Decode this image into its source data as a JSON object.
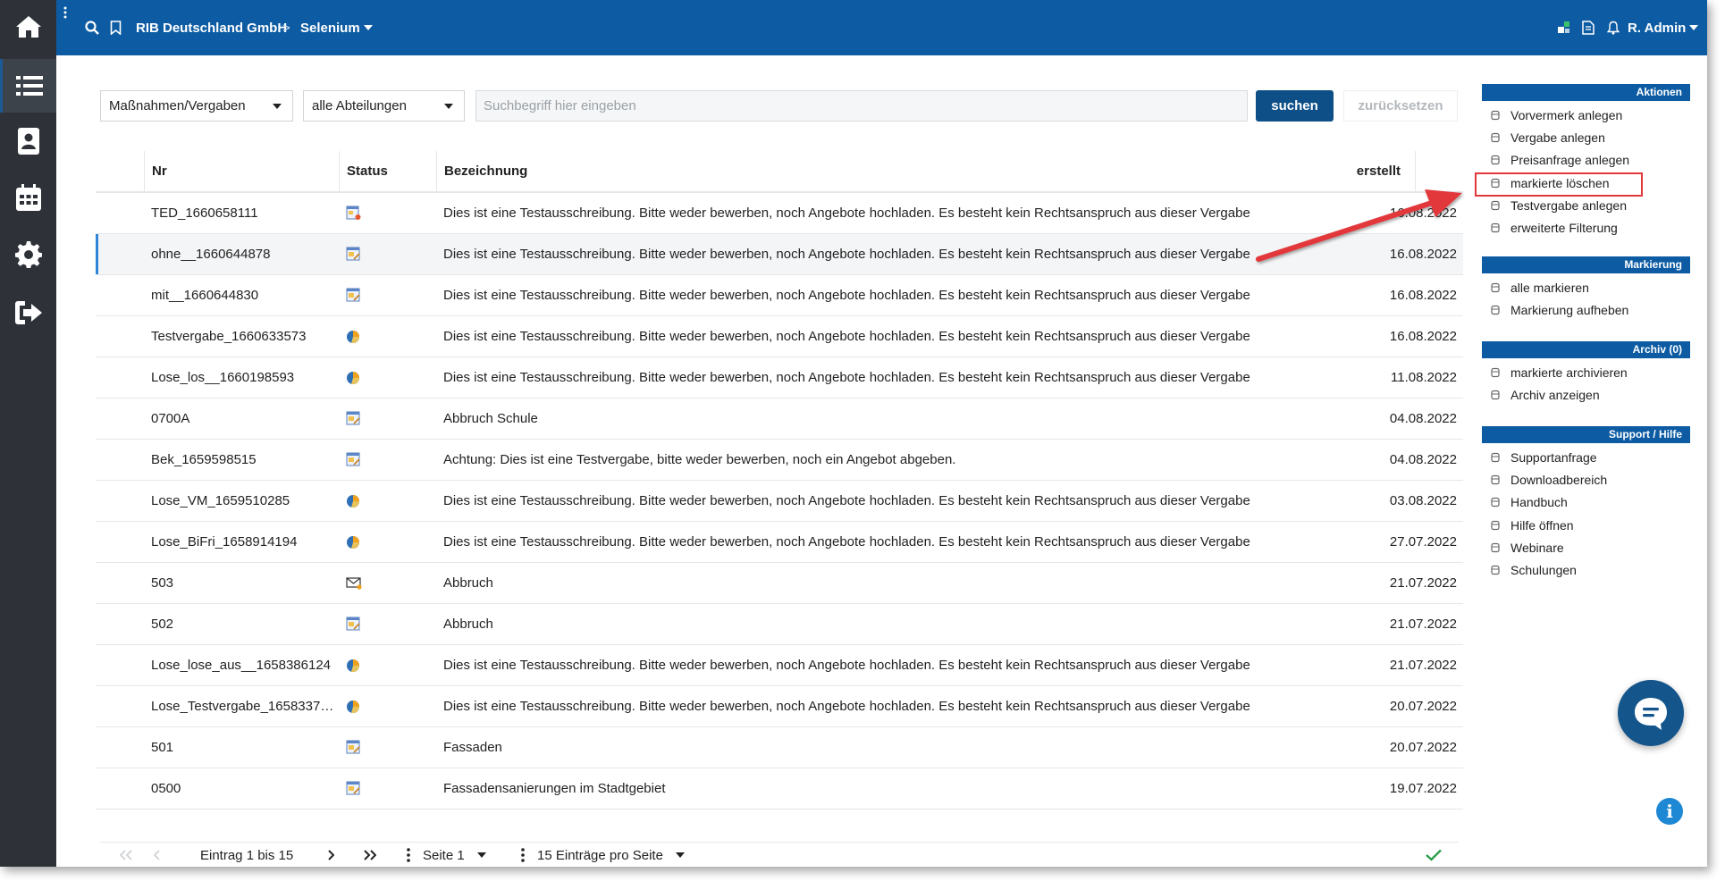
{
  "topbar": {
    "company": "RIB Deutschland GmbH",
    "separator": ">",
    "project": "Selenium",
    "user": "R. Admin"
  },
  "rail": {
    "items": [
      "home-icon",
      "list-icon",
      "address-book-icon",
      "calendar-icon",
      "gear-icon",
      "sign-out-icon"
    ],
    "active": "list-icon"
  },
  "filters": {
    "type_select": "Maßnahmen/Vergaben",
    "department_select": "alle Abteilungen",
    "search_placeholder": "Suchbegriff hier eingeben",
    "search_button": "suchen",
    "reset_button": "zurücksetzen"
  },
  "table": {
    "columns": {
      "nr": "Nr",
      "status": "Status",
      "bezeichnung": "Bezeichnung",
      "erstellt": "erstellt"
    },
    "rows": [
      {
        "nr": "TED_1660658111",
        "status_icon": "document-warning-icon",
        "bezeichnung": "Dies ist eine Testausschreibung. Bitte weder bewerben, noch Angebote hochladen. Es besteht kein Rechtsanspruch aus dieser Vergabe",
        "erstellt": "16.08.2022"
      },
      {
        "nr": "ohne__1660644878",
        "status_icon": "document-edit-icon",
        "bezeichnung": "Dies ist eine Testausschreibung. Bitte weder bewerben, noch Angebote hochladen. Es besteht kein Rechtsanspruch aus dieser Vergabe",
        "erstellt": "16.08.2022"
      },
      {
        "nr": "mit__1660644830",
        "status_icon": "document-edit-icon",
        "bezeichnung": "Dies ist eine Testausschreibung. Bitte weder bewerben, noch Angebote hochladen. Es besteht kein Rechtsanspruch aus dieser Vergabe",
        "erstellt": "16.08.2022"
      },
      {
        "nr": "Testvergabe_1660633573",
        "status_icon": "pie-chart-icon",
        "bezeichnung": "Dies ist eine Testausschreibung. Bitte weder bewerben, noch Angebote hochladen. Es besteht kein Rechtsanspruch aus dieser Vergabe",
        "erstellt": "16.08.2022"
      },
      {
        "nr": "Lose_los__1660198593",
        "status_icon": "pie-chart-icon",
        "bezeichnung": "Dies ist eine Testausschreibung. Bitte weder bewerben, noch Angebote hochladen. Es besteht kein Rechtsanspruch aus dieser Vergabe",
        "erstellt": "11.08.2022"
      },
      {
        "nr": "0700A",
        "status_icon": "document-edit-icon",
        "bezeichnung": "Abbruch Schule",
        "erstellt": "04.08.2022"
      },
      {
        "nr": "Bek_1659598515",
        "status_icon": "document-edit-icon",
        "bezeichnung": "Achtung: Dies ist eine Testvergabe, bitte weder bewerben, noch ein Angebot abgeben.",
        "erstellt": "04.08.2022"
      },
      {
        "nr": "Lose_VM_1659510285",
        "status_icon": "pie-chart-icon",
        "bezeichnung": "Dies ist eine Testausschreibung. Bitte weder bewerben, noch Angebote hochladen. Es besteht kein Rechtsanspruch aus dieser Vergabe",
        "erstellt": "03.08.2022"
      },
      {
        "nr": "Lose_BiFri_1658914194",
        "status_icon": "pie-chart-icon",
        "bezeichnung": "Dies ist eine Testausschreibung. Bitte weder bewerben, noch Angebote hochladen. Es besteht kein Rechtsanspruch aus dieser Vergabe",
        "erstellt": "27.07.2022"
      },
      {
        "nr": "503",
        "status_icon": "envelope-icon",
        "bezeichnung": "Abbruch",
        "erstellt": "21.07.2022"
      },
      {
        "nr": "502",
        "status_icon": "document-edit-icon",
        "bezeichnung": "Abbruch",
        "erstellt": "21.07.2022"
      },
      {
        "nr": "Lose_lose_aus__1658386124",
        "status_icon": "pie-chart-icon",
        "bezeichnung": "Dies ist eine Testausschreibung. Bitte weder bewerben, noch Angebote hochladen. Es besteht kein Rechtsanspruch aus dieser Vergabe",
        "erstellt": "21.07.2022"
      },
      {
        "nr": "Lose_Testvergabe_1658337…",
        "status_icon": "pie-chart-icon",
        "bezeichnung": "Dies ist eine Testausschreibung. Bitte weder bewerben, noch Angebote hochladen. Es besteht kein Rechtsanspruch aus dieser Vergabe",
        "erstellt": "20.07.2022"
      },
      {
        "nr": "501",
        "status_icon": "document-edit-icon",
        "bezeichnung": "Fassaden",
        "erstellt": "20.07.2022"
      },
      {
        "nr": "0500",
        "status_icon": "document-edit-icon",
        "bezeichnung": "Fassadensanierungen im Stadtgebiet",
        "erstellt": "19.07.2022"
      }
    ]
  },
  "pager": {
    "entries": "Eintrag 1 bis 15",
    "page": "Seite 1",
    "per_page": "15 Einträge pro Seite"
  },
  "panel": {
    "sections": [
      {
        "title": "Aktionen",
        "items": [
          "Vorvermerk anlegen",
          "Vergabe anlegen",
          "Preisanfrage anlegen",
          "markierte löschen",
          "Testvergabe anlegen",
          "erweiterte Filterung"
        ]
      },
      {
        "title": "Markierung",
        "items": [
          "alle markieren",
          "Markierung aufheben"
        ]
      },
      {
        "title": "Archiv (0)",
        "items": [
          "markierte archivieren",
          "Archiv anzeigen"
        ]
      },
      {
        "title": "Support / Hilfe",
        "items": [
          "Supportanfrage",
          "Downloadbereich",
          "Handbuch",
          "Hilfe öffnen",
          "Webinare",
          "Schulungen"
        ]
      }
    ]
  },
  "colors": {
    "brand": "#0d5ca3",
    "rail": "#2e3238",
    "annotation": "#e2383a",
    "ok": "#2a9d4a"
  }
}
